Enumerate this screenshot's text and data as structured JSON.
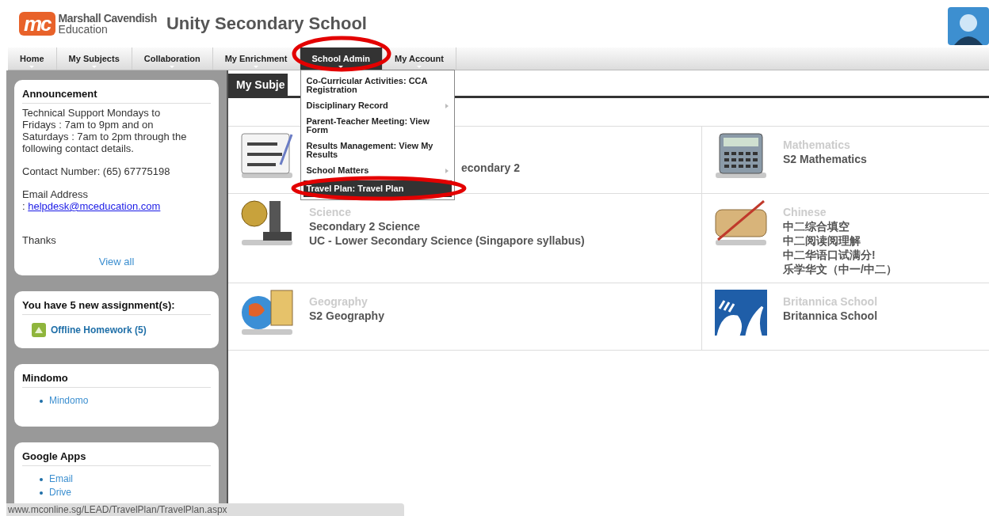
{
  "header": {
    "logo_mark": "mc",
    "logo_name": "Marshall Cavendish",
    "logo_sub": "Education",
    "school": "Unity Secondary School"
  },
  "nav": {
    "tabs": [
      {
        "label": "Home",
        "selected": false
      },
      {
        "label": "My Subjects",
        "selected": false
      },
      {
        "label": "Collaboration",
        "selected": false
      },
      {
        "label": "My Enrichment",
        "selected": false
      },
      {
        "label": "School Admin",
        "selected": true,
        "menu": [
          {
            "label": "Co-Curricular Activities: CCA Registration",
            "submenu": false,
            "selected": false
          },
          {
            "label": "Disciplinary Record",
            "submenu": true,
            "selected": false
          },
          {
            "label": "Parent-Teacher Meeting: View Form",
            "submenu": false,
            "selected": false
          },
          {
            "label": "Results Management: View My Results",
            "submenu": false,
            "selected": false
          },
          {
            "label": "School Matters",
            "submenu": true,
            "selected": false
          },
          {
            "label": "Travel Plan: Travel Plan",
            "submenu": false,
            "selected": true
          }
        ]
      },
      {
        "label": "My Account",
        "selected": false
      }
    ]
  },
  "sidebar": {
    "announcement": {
      "title": "Announcement",
      "paragraphs": [
        "Technical Support Mondays to Fridays : 7am to 9pm and on Saturdays : 7am to 2pm through the following contact details.",
        "Contact Number: (65) 67775198"
      ],
      "email_label": "Email Address",
      "email_prefix": ":",
      "email": "helpdesk@mceducation.com",
      "closing": "Thanks",
      "view_all": "View all"
    },
    "assignments": {
      "title": "You have 5 new assignment(s):",
      "link": "Offline Homework (5)"
    },
    "panels": [
      {
        "title": "Mindomo",
        "links": [
          "Mindomo"
        ]
      },
      {
        "title": "Google Apps",
        "links": [
          "Email",
          "Drive"
        ]
      }
    ]
  },
  "main": {
    "heading": "My Subje",
    "courses": [
      {
        "kind": "grammar",
        "titles": [
          "econdary 2"
        ]
      },
      {
        "kind": "math",
        "subject": "Mathematics",
        "titles": [
          "S2 Mathematics"
        ]
      },
      {
        "kind": "science",
        "subject": "Science",
        "titles": [
          "Secondary 2 Science",
          "UC - Lower Secondary Science (Singapore syllabus)"
        ]
      },
      {
        "kind": "chinese",
        "subject": "Chinese",
        "titles": [
          "中二综合填空",
          "中二阅读阅理解",
          "中二华语口试满分!",
          "乐学华文（中一/中二）"
        ]
      },
      {
        "kind": "geography",
        "subject": "Geography",
        "titles": [
          "S2 Geography"
        ]
      },
      {
        "kind": "britannica",
        "subject": "Britannica School",
        "titles": [
          "Britannica School"
        ]
      }
    ]
  },
  "status_bar": {
    "url": "www.mconline.sg/LEAD/TravelPlan/TravelPlan.aspx"
  }
}
